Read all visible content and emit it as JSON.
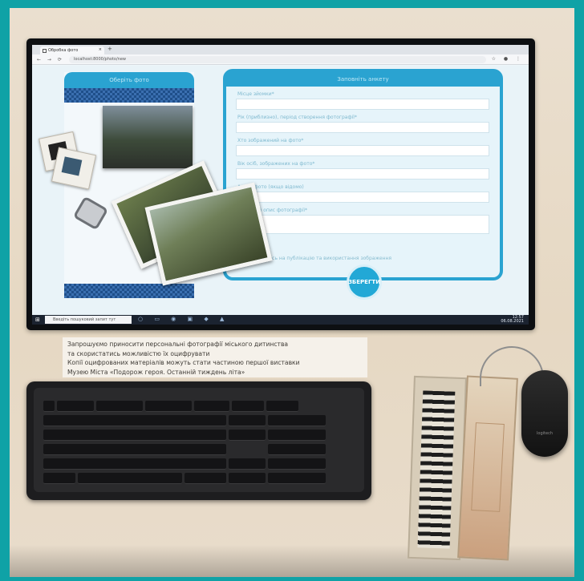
{
  "browser": {
    "tab_title": "Обробка фото",
    "tab_close": "×",
    "new_tab": "+",
    "url": "localhost:8000/photo/new",
    "nav_glyphs": "← → ⟳",
    "bar_glyphs": "☆ ● ⋮"
  },
  "left_panel": {
    "header": "Оберіть фото"
  },
  "form": {
    "header": "Заповніть анкету",
    "fields": [
      {
        "label": "Місце зйомки*"
      },
      {
        "label": "Рік (приблизно), період створення фотографії*"
      },
      {
        "label": "Хто зображений на фото*"
      },
      {
        "label": "Вік осіб, зображених на фото*"
      },
      {
        "label": "Автор фото (якщо відомо)"
      },
      {
        "label": "Короткий опис фотографії*"
      }
    ],
    "consent": "Погоджуюсь на публікацію та використання зображення",
    "save_label": "ЗБЕРЕГТИ"
  },
  "taskbar": {
    "start": "⊞",
    "search_placeholder": "Введіть пошуковий запит тут",
    "apps": "○ ▭ ◉ ▣ ◆ ▲",
    "time": "12:57",
    "date": "06.08.2021"
  },
  "caption": {
    "line1": "Запрошуємо приносити персональні фотографії міського дитинства",
    "line2": "та скористатись можливістю їх оцифрувати",
    "line3": "Копії оцифрованих матеріалів можуть стати частиною першої виставки",
    "line4": "Музею Міста «Подорож героя. Останній тиждень літа»"
  },
  "mouse": {
    "brand": "logitech"
  },
  "colors": {
    "accent": "#2aa3d1",
    "frame": "#0fa2a6"
  }
}
